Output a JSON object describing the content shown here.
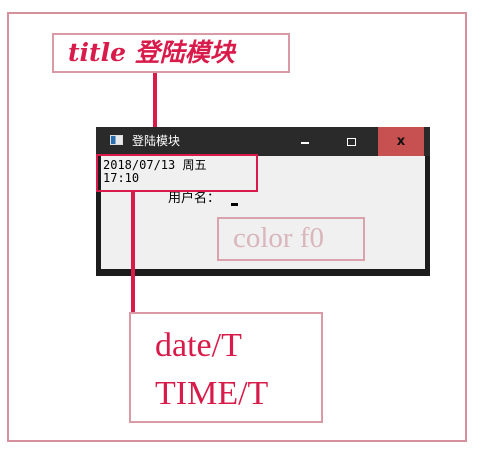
{
  "window": {
    "title": "登陆模块",
    "buttons": {
      "close": "x"
    },
    "datetime": "2018/07/13 周五\n17:10",
    "user_label": "用户名："
  },
  "annotations": {
    "title_label": "title 登陆模块",
    "color_label": "color f0",
    "datetime_line1": "date/T",
    "datetime_line2": "TIME/T"
  },
  "colors": {
    "accent": "#d81b4a",
    "window_bg": "#f0f0f0",
    "close_button": "#c75050"
  }
}
